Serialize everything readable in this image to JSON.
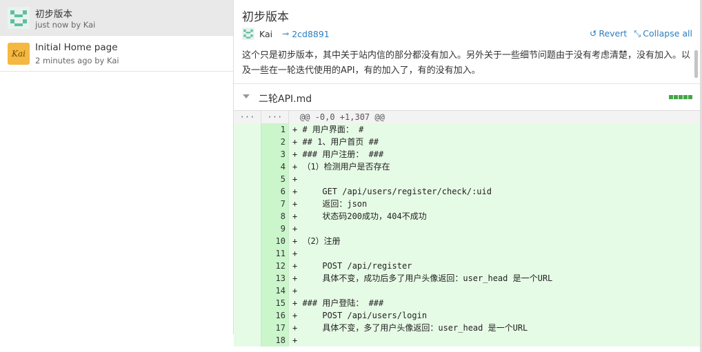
{
  "commits": [
    {
      "title": "初步版本",
      "meta": "just now by Kai",
      "avatar": "identicon",
      "selected": true
    },
    {
      "title": "Initial Home page",
      "meta": "2 minutes ago by Kai",
      "avatar": "kai-logo",
      "avatar_text": "Kai",
      "selected": false
    }
  ],
  "detail": {
    "title": "初步版本",
    "author": "Kai",
    "hash": "2cd8891",
    "revert_label": "Revert",
    "collapse_label": "Collapse all",
    "message": "这个只是初步版本，其中关于站内信的部分都没有加入。另外关于一些细节问题由于没有考虑清楚，没有加入。以及一些在一轮迭代使用的API，有的加入了，有的没有加入。"
  },
  "file": {
    "name": "二轮API.md"
  },
  "diff": {
    "hunk": {
      "old": "···",
      "new": "···",
      "text": "@@ -0,0 +1,307 @@"
    },
    "lines": [
      {
        "n": "1",
        "text": "+ # 用户界面： #"
      },
      {
        "n": "2",
        "text": "+ ## 1、用户首页 ##"
      },
      {
        "n": "3",
        "text": "+ ### 用户注册： ###"
      },
      {
        "n": "4",
        "text": "+ （1）检测用户是否存在"
      },
      {
        "n": "5",
        "text": "+"
      },
      {
        "n": "6",
        "text": "+     GET /api/users/register/check/:uid"
      },
      {
        "n": "7",
        "text": "+     返回：json"
      },
      {
        "n": "8",
        "text": "+     状态码200成功，404不成功"
      },
      {
        "n": "9",
        "text": "+"
      },
      {
        "n": "10",
        "text": "+ （2）注册"
      },
      {
        "n": "11",
        "text": "+"
      },
      {
        "n": "12",
        "text": "+     POST /api/register"
      },
      {
        "n": "13",
        "text": "+     具体不变，成功后多了用户头像返回：user_head 是一个URL"
      },
      {
        "n": "14",
        "text": "+"
      },
      {
        "n": "15",
        "text": "+ ### 用户登陆： ###"
      },
      {
        "n": "16",
        "text": "+     POST /api/users/login"
      },
      {
        "n": "17",
        "text": "+     具体不变，多了用户头像返回：user_head 是一个URL"
      },
      {
        "n": "18",
        "text": "+"
      }
    ]
  },
  "colors": {
    "link": "#2a7dbf",
    "added_bg": "#e6fbe6",
    "added_num_bg": "#cbf5cb",
    "stat_green": "#46a546"
  }
}
